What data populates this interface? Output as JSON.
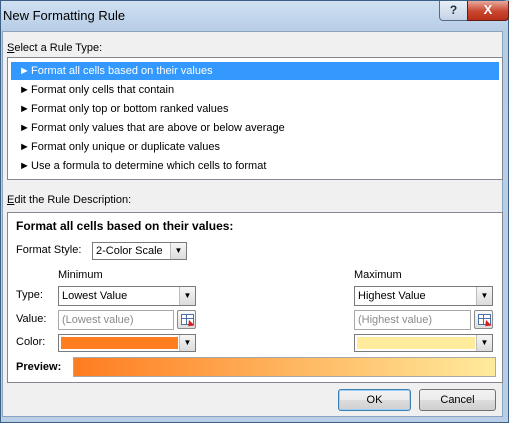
{
  "window": {
    "title": "New Formatting Rule",
    "help_label": "?",
    "close_label": "X"
  },
  "rule_type": {
    "label": "Select a Rule Type:",
    "items": [
      "Format all cells based on their values",
      "Format only cells that contain",
      "Format only top or bottom ranked values",
      "Format only values that are above or below average",
      "Format only unique or duplicate values",
      "Use a formula to determine which cells to format"
    ],
    "selected_index": 0,
    "arrow": "►"
  },
  "description": {
    "label": "Edit the Rule Description:",
    "heading": "Format all cells based on their values:",
    "format_style_label": "Format Style:",
    "format_style_value": "2-Color Scale",
    "minimum": {
      "header": "Minimum",
      "type": "Lowest Value",
      "value_placeholder": "(Lowest value)",
      "color": "#ff7c1f"
    },
    "maximum": {
      "header": "Maximum",
      "type": "Highest Value",
      "value_placeholder": "(Highest value)",
      "color": "#ffeb9c"
    },
    "type_label": "Type:",
    "value_label": "Value:",
    "color_label": "Color:",
    "preview_label": "Preview:"
  },
  "buttons": {
    "ok": "OK",
    "cancel": "Cancel"
  },
  "icons": {
    "dropdown": "dropdown-arrow-icon",
    "range_picker": "collapse-dialog-icon"
  }
}
